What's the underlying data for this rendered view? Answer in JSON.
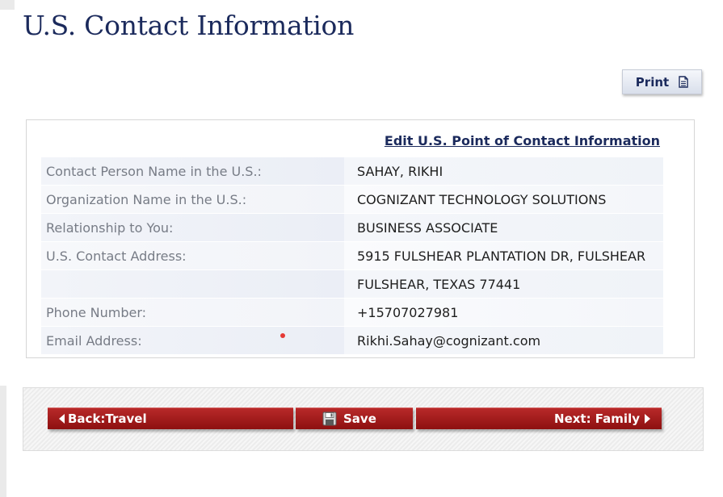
{
  "page": {
    "title": "U.S. Contact Information"
  },
  "toolbar": {
    "print_label": "Print",
    "print_icon": "document-icon"
  },
  "panel": {
    "edit_link": "Edit U.S. Point of Contact Information",
    "rows": [
      {
        "label": "Contact Person Name in the U.S.:",
        "value": "SAHAY, RIKHI"
      },
      {
        "label": "Organization Name in the U.S.:",
        "value": "COGNIZANT TECHNOLOGY SOLUTIONS"
      },
      {
        "label": "Relationship to You:",
        "value": "BUSINESS ASSOCIATE"
      },
      {
        "label": "U.S. Contact Address:",
        "value": "5915 FULSHEAR PLANTATION DR, FULSHEAR"
      },
      {
        "label": "",
        "value": "FULSHEAR, TEXAS 77441"
      },
      {
        "label": "Phone Number:",
        "value": "+15707027981"
      },
      {
        "label": "Email Address:",
        "value": "Rikhi.Sahay@cognizant.com",
        "required_marker": true
      }
    ]
  },
  "nav": {
    "back_label": "Back:Travel",
    "save_label": "Save",
    "next_label": "Next: Family",
    "button_color": "#a31d1d"
  },
  "colors": {
    "title": "#1b2a5c",
    "required_dot": "#e53935"
  }
}
